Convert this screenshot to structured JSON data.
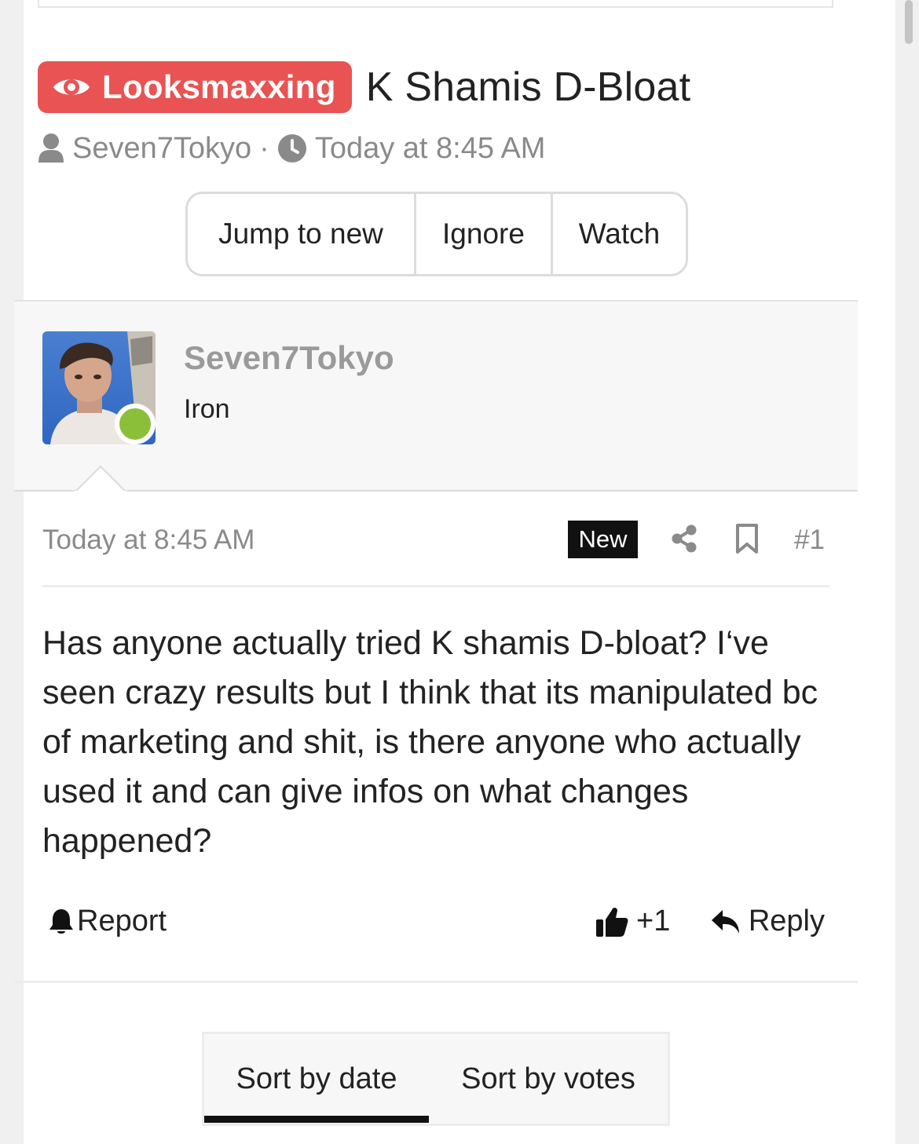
{
  "thread": {
    "prefix": "Looksmaxxing",
    "title": "K Shamis D-Bloat",
    "author": "Seven7Tokyo",
    "separator": "·",
    "date": "Today at 8:45 AM"
  },
  "thread_actions": {
    "jump_label": "Jump to new",
    "ignore_label": "Ignore",
    "watch_label": "Watch"
  },
  "post": {
    "username": "Seven7Tokyo",
    "user_title": "Iron",
    "date": "Today at 8:45 AM",
    "new_label": "New",
    "number": "#1",
    "body": "Has anyone actually tried K shamis D-bloat? I‘ve seen crazy results but I think that its manipulated bc of marketing and shit, is there anyone who actually used it and can give infos on what changes happened?",
    "report_label": "Report",
    "reaction_count": "+1",
    "reply_label": "Reply"
  },
  "sort": {
    "by_date": "Sort by date",
    "by_votes": "Sort by votes",
    "active": "by_date"
  },
  "colors": {
    "prefix_bg": "#e95353",
    "online": "#8bbf3a",
    "muted_text": "#8a8a8a"
  },
  "icons": [
    "eye-icon",
    "user-icon",
    "clock-icon",
    "share-icon",
    "bookmark-icon",
    "bell-icon",
    "thumbs-up-icon",
    "reply-icon"
  ]
}
